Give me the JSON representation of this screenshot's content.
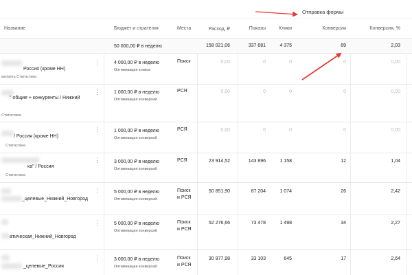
{
  "header": {
    "goal_label": "Отправка формы",
    "columns": {
      "name": "Название",
      "budget": "Бюджет и стратегия",
      "places": "Места",
      "spend": "Расход, ₽",
      "impressions": "Показы",
      "clicks": "Клики",
      "conversions": "Конверсии",
      "conv_rate": "Конверсия, %"
    }
  },
  "summary": {
    "budget": "50 000,00 ₽ в неделю",
    "spend": "158 021,06",
    "impressions": "337 681",
    "clicks": "4 375",
    "conversions": "89",
    "conv_rate": "2,03"
  },
  "rows": [
    {
      "name": "Россия (кроме НН)",
      "sub": "мотреть  Статистика",
      "budget": "4 000,00 ₽ в неделю",
      "strategy": "Оптимизация кликов",
      "place1": "Поиск",
      "place2": "",
      "spend": "0,00",
      "impressions": "0",
      "clicks": "0",
      "conversions": "0",
      "conv_rate": "0,00"
    },
    {
      "name": "\" общие + конкуренты / Нижний",
      "sub": "Статистика",
      "budget": "1 000,00 ₽ в неделю",
      "strategy": "Оптимизация конверсий",
      "place1": "РСЯ",
      "place2": "",
      "spend": "0,00",
      "impressions": "0",
      "clicks": "0",
      "conversions": "0",
      "conv_rate": "0,00"
    },
    {
      "name": "/ Россия (кроме НН)",
      "sub": "Статистика",
      "budget": "1 000,00 ₽ в неделю",
      "strategy": "Оптимизация конверсий",
      "place1": "РСЯ",
      "place2": "",
      "spend": "0,00",
      "impressions": "0",
      "clicks": "0",
      "conversions": "0",
      "conv_rate": "0,00"
    },
    {
      "name": "ка\" / Россия",
      "sub": "Статистика",
      "budget": "3 000,00 ₽ в неделю",
      "strategy": "Оптимизация конверсий",
      "place1": "РСЯ",
      "place2": "",
      "spend": "23 914,52",
      "impressions": "143 896",
      "clicks": "1 158",
      "conversions": "12",
      "conv_rate": "1,04"
    },
    {
      "name": "_целевые_Нижний_Новгород",
      "sub": "",
      "budget": "5 000,00 ₽ в неделю",
      "strategy": "Оптимизация конверсий",
      "place1": "Поиск",
      "place2": "и РСЯ",
      "spend": "50 851,90",
      "impressions": "87 204",
      "clicks": "1 074",
      "conversions": "26",
      "conv_rate": "2,42"
    },
    {
      "name": "атическая_Нижний_Новгород",
      "sub": "",
      "budget": "5 000,00 ₽ в неделю",
      "strategy": "Оптимизация конверсий",
      "place1": "Поиск",
      "place2": "и РСЯ",
      "spend": "52 276,66",
      "impressions": "73 478",
      "clicks": "1 498",
      "conversions": "34",
      "conv_rate": "2,27"
    },
    {
      "name": "_целевые_Россия",
      "sub": "",
      "budget": "3 000,00 ₽ в неделю",
      "strategy": "Оптимизация конверсий",
      "place1": "Поиск",
      "place2": "и РСЯ",
      "spend": "30 977,98",
      "impressions": "33 103",
      "clicks": "645",
      "conversions": "17",
      "conv_rate": "2,64"
    }
  ],
  "accent_arrow_color": "#e53935",
  "icons": {
    "row_menu": "more-vert-icon"
  }
}
